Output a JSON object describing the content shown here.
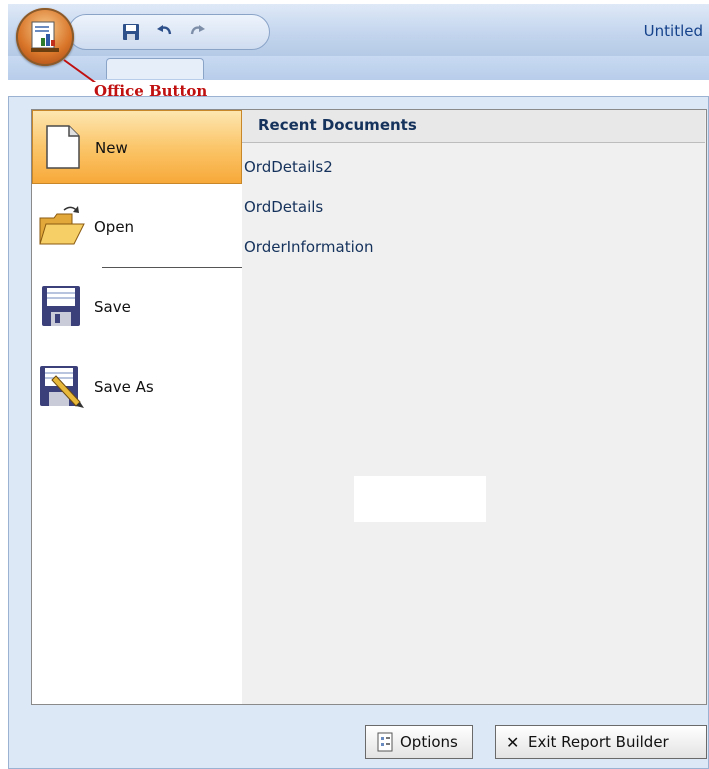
{
  "window": {
    "title": "Untitled"
  },
  "quick_access": [
    {
      "icon": "save-icon"
    },
    {
      "icon": "undo-icon"
    },
    {
      "icon": "redo-icon"
    }
  ],
  "callout": {
    "label": "Office Button",
    "color": "#c01010"
  },
  "menu": {
    "commands": [
      {
        "label": "New",
        "icon": "new-document-icon",
        "selected": true
      },
      {
        "label": "Open",
        "icon": "open-folder-icon",
        "selected": false
      },
      {
        "label": "Save",
        "icon": "floppy-disk-icon",
        "selected": false
      },
      {
        "label": "Save As",
        "icon": "save-as-icon",
        "selected": false
      }
    ],
    "recent": {
      "title": "Recent Documents",
      "items": [
        "OrdDetails2",
        "OrdDetails",
        "OrderInformation"
      ]
    },
    "footer": {
      "options_label": "Options",
      "exit_label": "Exit Report Builder"
    }
  },
  "colors": {
    "selected_command": "#fbc66a",
    "menu_background": "#dde8f6",
    "recent_text": "#15325c"
  }
}
